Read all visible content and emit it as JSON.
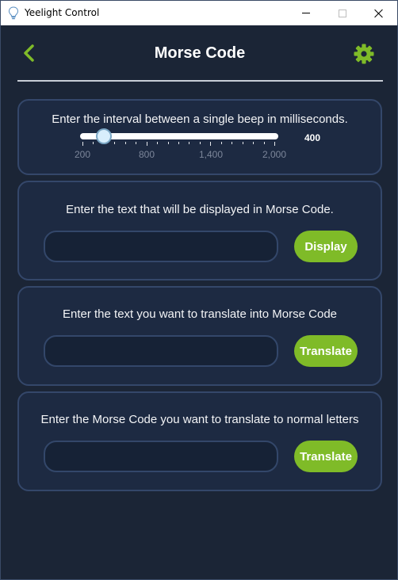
{
  "window": {
    "title": "Yeelight Control",
    "icon": "lightbulb-icon"
  },
  "header": {
    "title": "Morse Code",
    "back_icon": "chevron-left-icon",
    "settings_icon": "gear-icon",
    "accent_color": "#7fbb28"
  },
  "interval": {
    "label": "Enter the interval between a single beep in milliseconds.",
    "value": "400",
    "min": 200,
    "max": 2000,
    "tick_labels": [
      "200",
      "800",
      "1,400",
      "2,000"
    ]
  },
  "display": {
    "label": "Enter the text that will be displayed in Morse Code.",
    "input_value": "",
    "button_label": "Display"
  },
  "to_morse": {
    "label": "Enter the text you want to translate into Morse Code",
    "input_value": "",
    "button_label": "Translate"
  },
  "to_letters": {
    "label": "Enter the Morse Code you want to translate to normal letters",
    "input_value": "",
    "button_label": "Translate"
  }
}
